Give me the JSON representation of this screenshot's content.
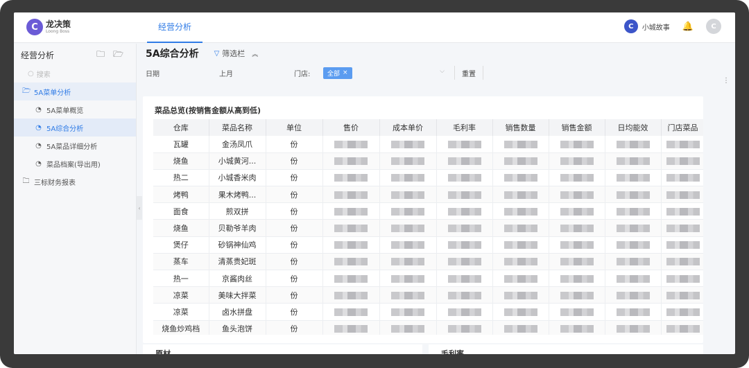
{
  "app": {
    "logo_mark": "C",
    "name_cn": "龙决策",
    "name_en": "Loong Boss"
  },
  "top_nav": {
    "tab": "经营分析"
  },
  "user": {
    "store_icon": "C",
    "store_name": "小城故事",
    "avatar": "C"
  },
  "sidebar": {
    "header": "经营分析",
    "search_placeholder": "搜索",
    "items": [
      {
        "label": "5A菜单分析",
        "level": 1
      },
      {
        "label": "5A菜单概览",
        "level": 2
      },
      {
        "label": "5A综合分析",
        "level": 2
      },
      {
        "label": "5A菜品详细分析",
        "level": 2
      },
      {
        "label": "菜品档案(导出用)",
        "level": 2
      },
      {
        "label": "三标财务报表",
        "level": 1
      }
    ]
  },
  "page": {
    "title": "5A综合分析",
    "filter_toggle": "筛选栏",
    "filters": {
      "date_label": "日期",
      "month_label": "上月",
      "store_label": "门店:",
      "store_tag": "全部",
      "reset": "重置"
    }
  },
  "card": {
    "title": "菜品总览(按销售金额从高到低)",
    "columns": [
      "仓库",
      "菜品名称",
      "单位",
      "售价",
      "成本单价",
      "毛利率",
      "销售数量",
      "销售金额",
      "日均能效",
      "门店菜品"
    ],
    "rows": [
      [
        "瓦罐",
        "金汤凤爪",
        "份"
      ],
      [
        "烧鱼",
        "小城黄河...",
        "份"
      ],
      [
        "热二",
        "小城香米肉",
        "份"
      ],
      [
        "烤鸭",
        "果木烤鸭...",
        "份"
      ],
      [
        "面食",
        "煎双拼",
        "份"
      ],
      [
        "烧鱼",
        "贝勒爷羊肉",
        "份"
      ],
      [
        "煲仔",
        "砂锅神仙鸡",
        "份"
      ],
      [
        "蒸车",
        "清蒸贵妃斑",
        "份"
      ],
      [
        "热一",
        "京酱肉丝",
        "份"
      ],
      [
        "凉菜",
        "美味大拌菜",
        "份"
      ],
      [
        "凉菜",
        "卤水拼盘",
        "份"
      ],
      [
        "烧鱼炒鸡档",
        "鱼头泡饼",
        "份"
      ]
    ]
  },
  "bottom_cards": {
    "left_title": "原材",
    "right_title": "毛利率"
  }
}
